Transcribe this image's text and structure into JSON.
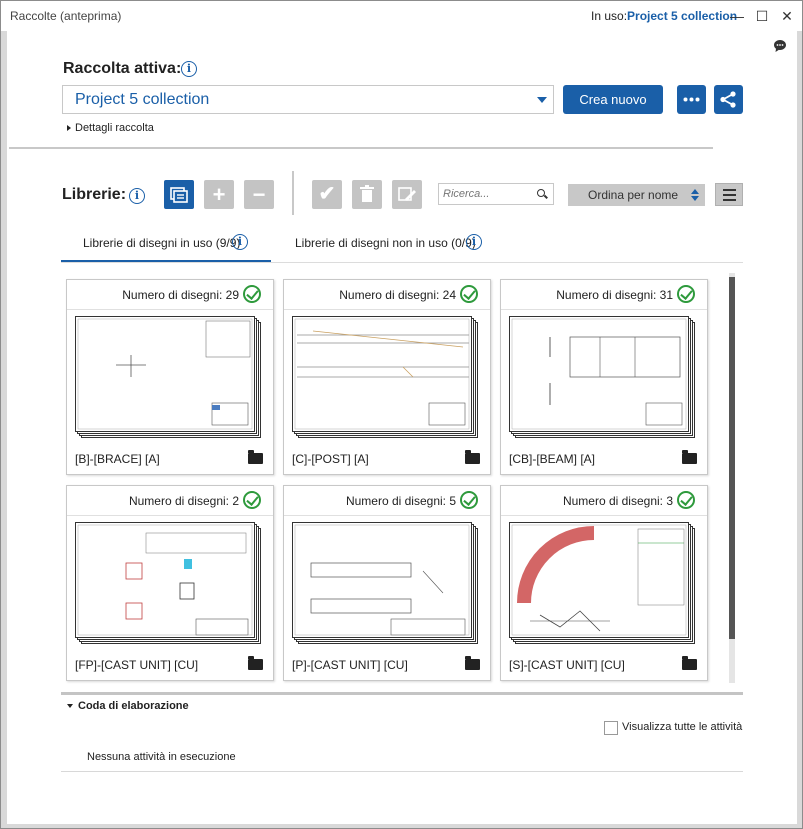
{
  "window": {
    "title": "Raccolte (anteprima)",
    "in_use_label": "In uso:",
    "in_use_value": "Project 5 collection"
  },
  "collection": {
    "label": "Raccolta attiva:",
    "selected": "Project 5 collection",
    "create_new": "Crea nuovo",
    "details": "Dettagli raccolta"
  },
  "libraries": {
    "label": "Librerie:",
    "search_placeholder": "Ricerca...",
    "sort": "Ordina per nome",
    "tabs": [
      {
        "label": "Librerie di disegni in uso (9/9)",
        "active": true
      },
      {
        "label": "Librerie di disegni non in uso (0/9)",
        "active": false
      }
    ],
    "cards": [
      {
        "count_label": "Numero di disegni: 29",
        "name": "[B]-[BRACE] [A]"
      },
      {
        "count_label": "Numero di disegni: 24",
        "name": "[C]-[POST] [A]"
      },
      {
        "count_label": "Numero di disegni: 31",
        "name": "[CB]-[BEAM] [A]"
      },
      {
        "count_label": "Numero di disegni: 2",
        "name": "[FP]-[CAST UNIT] [CU]"
      },
      {
        "count_label": "Numero di disegni: 5",
        "name": "[P]-[CAST UNIT] [CU]"
      },
      {
        "count_label": "Numero di disegni: 3",
        "name": "[S]-[CAST UNIT] [CU]"
      }
    ]
  },
  "queue": {
    "title": "Coda di elaborazione",
    "show_all": "Visualizza tutte le attività",
    "status": "Nessuna attività in esecuzione"
  },
  "colors": {
    "accent": "#1a5fa8",
    "success": "#2e9a3c",
    "disabled": "#c4c4c4"
  }
}
